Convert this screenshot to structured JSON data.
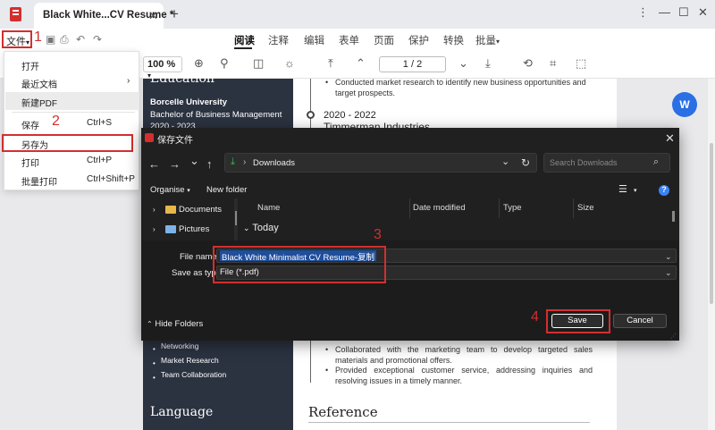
{
  "app": {
    "tab_title": "Black White...CV Resume *",
    "tab_close": "✕",
    "tab_add": "+",
    "window_controls": [
      "⋮",
      "—",
      "☐",
      "✕"
    ]
  },
  "menubar": {
    "file_label": "文件",
    "file_caret": "▾",
    "nav": [
      {
        "label": "阅读"
      },
      {
        "label": "注释"
      },
      {
        "label": "编辑"
      },
      {
        "label": "表单"
      },
      {
        "label": "页面"
      },
      {
        "label": "保护"
      },
      {
        "label": "转换"
      },
      {
        "label": "批量"
      }
    ],
    "batch_caret": "▾"
  },
  "toolbar": {
    "zoom": "100 %",
    "zoom_caret": "▾",
    "page_indicator": "1 / 2"
  },
  "file_dropdown": {
    "items": [
      {
        "label": "打开",
        "shortcut": ""
      },
      {
        "label": "最近文档",
        "shortcut": ""
      },
      {
        "label": "新建PDF",
        "shortcut": ""
      },
      {
        "label": "保存",
        "shortcut": "Ctrl+S"
      },
      {
        "label": "另存为",
        "shortcut": ""
      },
      {
        "label": "打印",
        "shortcut": "Ctrl+P"
      },
      {
        "label": "批量打印",
        "shortcut": "Ctrl+Shift+P"
      }
    ],
    "submenu_arrow": "›"
  },
  "steps": [
    "1",
    "2",
    "3",
    "4"
  ],
  "document": {
    "left": {
      "education_heading": "Education",
      "university": "Borcelle University",
      "degree": "Bachelor of Business Management",
      "years": "2020 - 2023",
      "skills": [
        "Networking",
        "Market Research",
        "Team Collaboration"
      ],
      "language_heading": "Language"
    },
    "right": {
      "bullet_top": "Conducted market research to identify new business opportunities and target prospects.",
      "date_range": "2020 - 2022",
      "company": "Timmerman Industries",
      "bullets_lower": [
        "Collaborated with the marketing team to develop targeted sales materials and promotional offers.",
        "Provided exceptional customer service, addressing inquiries and resolving issues in a timely manner."
      ],
      "reference_heading": "Reference"
    },
    "word_badge": "W"
  },
  "save_dialog": {
    "title": "保存文件",
    "close": "✕",
    "nav": {
      "back": "←",
      "forward": "→",
      "down": "⌄",
      "up": "↑"
    },
    "address": "Downloads",
    "address_sep": "›",
    "address_caret": "⌄",
    "refresh": "↻",
    "search_placeholder": "Search Downloads",
    "organise": "Organise",
    "new_folder": "New folder",
    "view_caret": "▾",
    "help": "?",
    "nav_pane": [
      {
        "label": "Documents"
      },
      {
        "label": "Pictures"
      }
    ],
    "columns": [
      "Name",
      "Date modified",
      "Type",
      "Size"
    ],
    "group": "Today",
    "file_name_label": "File name",
    "file_name_value": "Black White Minimalist CV Resume-复制",
    "save_as_type_label": "Save as type",
    "save_as_type_value": "File (*.pdf)",
    "hide_folders": "Hide Folders",
    "save_button": "Save",
    "cancel_button": "Cancel"
  },
  "colors": {
    "accent_red": "#d32f2f",
    "dialog_bg": "#202020",
    "resume_sidebar": "#2b3240",
    "word_blue": "#2a6fe3"
  }
}
